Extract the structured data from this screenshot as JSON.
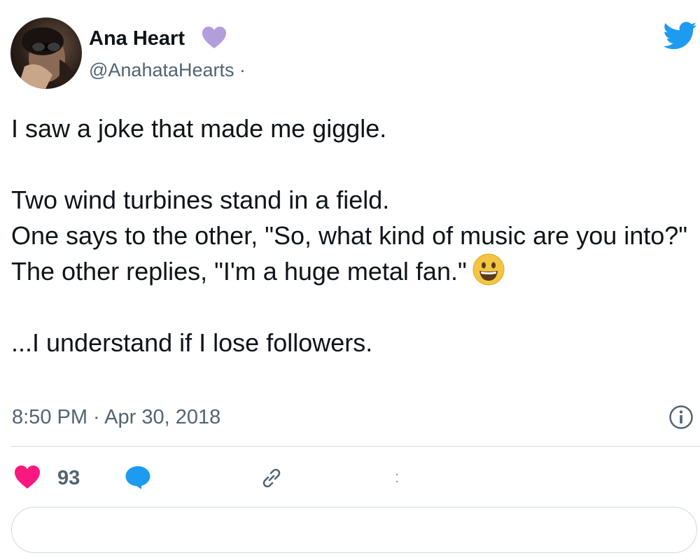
{
  "author": {
    "display_name": "Ana Heart",
    "handle": "@AnahataHearts ·",
    "name_badge_icon": "purple-heart-icon",
    "avatar_icon": "profile-photo"
  },
  "tweet": {
    "lines": [
      "I saw a joke that made me giggle.",
      "Two wind turbines stand in a field.",
      "One says to the other, \"So, what kind of music are you into?\"",
      "The other replies, \"I'm a huge metal fan.\"",
      "...I understand if I lose followers."
    ],
    "emoji": "grinning-face-emoji",
    "timestamp": "8:50 PM · Apr 30, 2018"
  },
  "actions": {
    "like_count": "93",
    "more_mark": ":"
  },
  "icons": {
    "brand": "twitter-bird-icon",
    "info": "info-icon",
    "like": "heart-icon",
    "reply": "speech-bubble-icon",
    "copy_link": "link-icon"
  },
  "colors": {
    "brand_blue": "#1d9bf0",
    "like_pink": "#f91880",
    "badge_purple": "#b39ddb",
    "secondary_text": "#536471",
    "divider": "#cfd9de"
  }
}
